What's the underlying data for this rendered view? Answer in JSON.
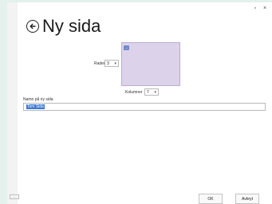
{
  "window": {
    "minimize": "▫",
    "close": "×"
  },
  "page": {
    "title": "Ny sida"
  },
  "rows": {
    "label": "Rader",
    "value": "3"
  },
  "columns": {
    "label": "Kolumner",
    "value": "7"
  },
  "name_field": {
    "label": "Namn på ny sida",
    "value": "Tom Sida"
  },
  "corner_button": "⋯⋯",
  "buttons": {
    "ok": "OK",
    "cancel": "Avbryt"
  },
  "colors": {
    "preview_fill": "#dcd3ea",
    "selection": "#3b78d4",
    "background": "#e4f1ec"
  }
}
